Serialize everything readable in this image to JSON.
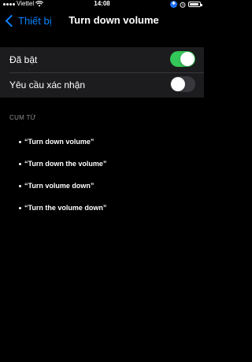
{
  "status_bar": {
    "carrier": "Viettel",
    "time": "14:08",
    "battery_level": 0.9
  },
  "nav": {
    "back_label": "Thiết bị",
    "title": "Turn down volume"
  },
  "settings": {
    "rows": [
      {
        "label": "Đã bật",
        "toggle_on": true
      },
      {
        "label": "Yêu cầu xác nhận",
        "toggle_on": false
      }
    ]
  },
  "phrases_section": {
    "header": "CỤM TỪ",
    "items": [
      "“Turn down volume”",
      "“Turn down the volume”",
      "“Turn volume down”",
      "“Turn the volume down”"
    ]
  },
  "colors": {
    "accent": "#0a84ff",
    "toggle_on": "#34c759",
    "toggle_off": "#39393d",
    "group_bg": "#1c1c1e"
  }
}
